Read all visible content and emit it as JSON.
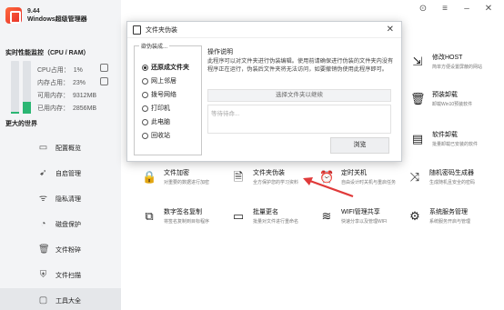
{
  "app": {
    "version": "9.44",
    "name": "Windows超级管理器"
  },
  "window_controls": [
    {
      "name": "settings-icon",
      "glyph": "⊙"
    },
    {
      "name": "menu-icon",
      "glyph": "≡"
    },
    {
      "name": "minimize-icon",
      "glyph": "–"
    },
    {
      "name": "close-icon",
      "glyph": "✕"
    }
  ],
  "performance": {
    "title": "实时性能监控（CPU / RAM）",
    "cpu_label": "CPU占用：",
    "cpu_value": "1%",
    "ram_label": "内存占用：",
    "ram_value": "23%",
    "available_label": "可用内存：",
    "available_value": "9312MB",
    "used_label": "已用内存：",
    "used_value": "2856MB",
    "cpu_fraction": 0.01,
    "ram_fraction": 0.23,
    "gauge_color": "#2bb673"
  },
  "more_title": "更大的世界",
  "nav": [
    {
      "label": "配置概览",
      "icon": "monitor-icon",
      "glyph": "▭"
    },
    {
      "label": "自启管理",
      "icon": "rocket-icon",
      "glyph": "➹"
    },
    {
      "label": "隐私清理",
      "icon": "eye-icon",
      "glyph": "ᯤ"
    },
    {
      "label": "磁盘保护",
      "icon": "pie-icon",
      "glyph": "◔"
    },
    {
      "label": "文件粉碎",
      "icon": "trash-icon",
      "glyph": "🗑"
    },
    {
      "label": "文件扫描",
      "icon": "shield-icon",
      "glyph": "⛨"
    },
    {
      "label": "工具大全",
      "icon": "bag-icon",
      "glyph": "▢"
    }
  ],
  "nav_active": 6,
  "right_tools": [
    {
      "name": "修改HOST",
      "desc": "简单方便设置屏蔽的网站",
      "glyph": "⇲"
    },
    {
      "name": "预装卸载",
      "desc": "卸载Win10预装软件",
      "glyph": "🗑"
    },
    {
      "name": "软件卸载",
      "desc": "批量卸载已安装的软件",
      "glyph": "▤"
    }
  ],
  "tools_row1": [
    {
      "name": "文件加密",
      "desc": "对重要的数据进行加密",
      "glyph": "🔒"
    },
    {
      "name": "文件夹伪装",
      "desc": "全方保护您的学习资料",
      "glyph": "🗎"
    },
    {
      "name": "定时关机",
      "desc": "自由设计时关机与重启任务",
      "glyph": "⏰"
    },
    {
      "name": "随机密码生成器",
      "desc": "生成随机且安全的密码",
      "glyph": "⤨"
    }
  ],
  "tools_row2": [
    {
      "name": "数字签名复制",
      "desc": "将签名复制到目标程序",
      "glyph": "⧉"
    },
    {
      "name": "批量更名",
      "desc": "批量对文件进行重命名",
      "glyph": "▭"
    },
    {
      "name": "WIFI管理共享",
      "desc": "快速分享以及管理WIFI",
      "glyph": "≋"
    },
    {
      "name": "系统服务管理",
      "desc": "系统服务开启与管理",
      "glyph": "⚙"
    }
  ],
  "dialog": {
    "title": "文件夹伪装",
    "close": "✕",
    "group_label": "欲伪装成...",
    "options": [
      "还原成文件夹",
      "网上邻居",
      "拨号网络",
      "打印机",
      "此电脑",
      "回收站"
    ],
    "selected_option": 0,
    "op_title": "操作说明",
    "op_text": "此程序可以对文件夹进行伪装编辑。使用前请确保进行伪装的文件夹内没有程序正在运行，伪装后文件夹将无法访问，如要撤销伪使用此程序即可。",
    "select_button": "选择文件夹以继续",
    "path_placeholder": "等待待命...",
    "browse_button": "浏览"
  },
  "annotation": {
    "arrow_color": "#e03a3a"
  }
}
